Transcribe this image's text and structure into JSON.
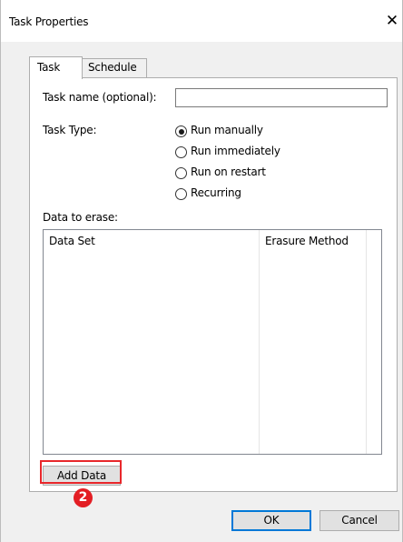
{
  "window": {
    "title": "Task Properties",
    "close_glyph": "✕"
  },
  "tabs": [
    {
      "label": "Task",
      "selected": true
    },
    {
      "label": "Schedule",
      "selected": false
    }
  ],
  "task": {
    "name_label": "Task name (optional):",
    "name_value": "",
    "type_label": "Task Type:",
    "type_options": [
      {
        "label": "Run manually",
        "selected": true
      },
      {
        "label": "Run immediately",
        "selected": false
      },
      {
        "label": "Run on restart",
        "selected": false
      },
      {
        "label": "Recurring",
        "selected": false
      }
    ],
    "data_label": "Data to erase:",
    "columns": [
      "Data Set",
      "Erasure Method"
    ],
    "rows": [],
    "add_button": "Add Data"
  },
  "annotation": {
    "badge": "2",
    "color": "#e31e24"
  },
  "footer": {
    "ok": "OK",
    "cancel": "Cancel"
  }
}
